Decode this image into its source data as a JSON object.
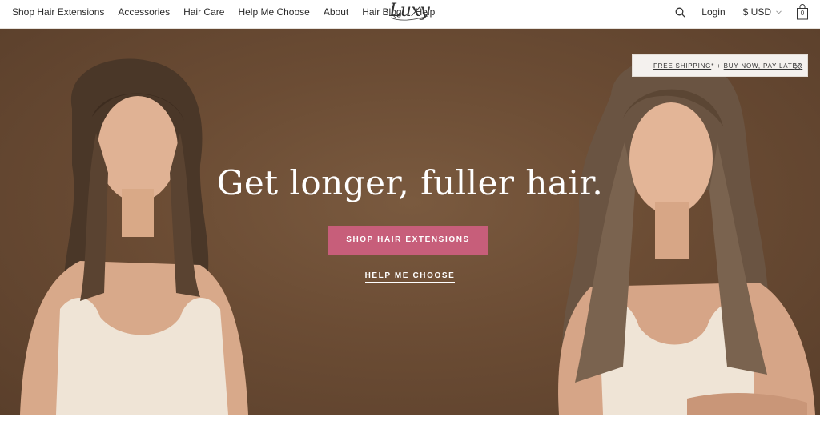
{
  "nav": {
    "links": [
      {
        "label": "Shop Hair Extensions"
      },
      {
        "label": "Accessories"
      },
      {
        "label": "Hair Care"
      },
      {
        "label": "Help Me Choose"
      },
      {
        "label": "About"
      },
      {
        "label": "Hair Blog"
      },
      {
        "label": "Help"
      }
    ],
    "logo_text": "Luxy",
    "login_label": "Login",
    "currency_label": "$ USD",
    "cart_count": "0"
  },
  "hero": {
    "headline": "Get longer, fuller hair.",
    "primary_cta": "SHOP HAIR EXTENSIONS",
    "secondary_cta": "HELP ME CHOOSE",
    "cta_color": "#c75e7a"
  },
  "promo": {
    "free_shipping": "FREE SHIPPING",
    "asterisk": "*",
    "joiner": " + ",
    "bnpl": "BUY NOW, PAY LATER"
  },
  "icons": {
    "search": "search-icon",
    "currency_chevron": "chevron-down-icon",
    "cart": "shopping-bag-icon",
    "promo_close": "close-icon"
  }
}
